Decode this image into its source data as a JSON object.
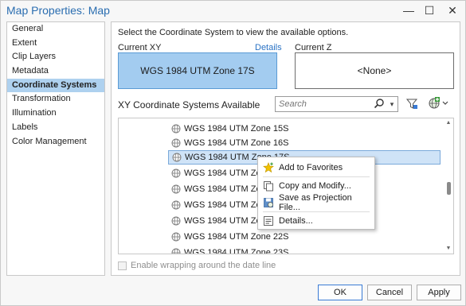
{
  "window": {
    "title": "Map Properties: Map",
    "minimize_glyph": "—",
    "maximize_glyph": "☐",
    "close_glyph": "✕"
  },
  "nav": {
    "items": [
      {
        "label": "General"
      },
      {
        "label": "Extent"
      },
      {
        "label": "Clip Layers"
      },
      {
        "label": "Metadata"
      },
      {
        "label": "Coordinate Systems",
        "active": true
      },
      {
        "label": "Transformation"
      },
      {
        "label": "Illumination"
      },
      {
        "label": "Labels"
      },
      {
        "label": "Color Management"
      }
    ]
  },
  "panel": {
    "instruction": "Select the Coordinate System to view the available options.",
    "current_xy_label": "Current XY",
    "details_link": "Details",
    "current_xy_value": "WGS 1984 UTM Zone 17S",
    "current_z_label": "Current Z",
    "current_z_value": "<None>",
    "available_heading": "XY Coordinate Systems Available",
    "search_placeholder": "Search",
    "list": [
      {
        "label": "WGS 1984 UTM Zone 15S"
      },
      {
        "label": "WGS 1984 UTM Zone 16S"
      },
      {
        "label": "WGS 1984 UTM Zone 17S",
        "selected": true
      },
      {
        "label": "WGS 1984 UTM Zone 18S"
      },
      {
        "label": "WGS 1984 UTM Zone 19S"
      },
      {
        "label": "WGS 1984 UTM Zone 20S"
      },
      {
        "label": "WGS 1984 UTM Zone 21S"
      },
      {
        "label": "WGS 1984 UTM Zone 22S"
      },
      {
        "label": "WGS 1984 UTM Zone 23S"
      }
    ],
    "wrap_label": "Enable wrapping around the date line"
  },
  "context_menu": {
    "items": [
      {
        "label": "Add to Favorites",
        "icon": "star-icon"
      },
      {
        "label": "Copy and Modify...",
        "icon": "copy-icon"
      },
      {
        "label": "Save as Projection File...",
        "icon": "save-projection-icon"
      },
      {
        "label": "Details...",
        "icon": "details-icon"
      }
    ]
  },
  "buttons": {
    "ok": "OK",
    "cancel": "Cancel",
    "apply": "Apply"
  },
  "colors": {
    "accent": "#2a6db0",
    "selection": "#aed1ef",
    "current_xy_bg": "#a3ccf0"
  }
}
